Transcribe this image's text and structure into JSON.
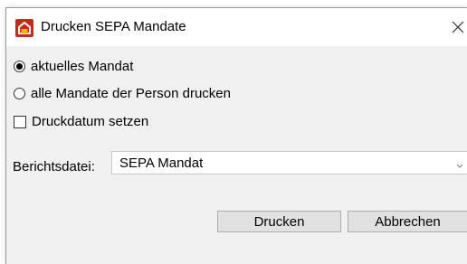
{
  "window": {
    "title": "Drucken SEPA Mandate",
    "icon": "app-house-icon",
    "close_icon": "close-icon"
  },
  "options": {
    "radio_current": {
      "label": "aktuelles Mandat",
      "checked": true
    },
    "radio_all": {
      "label": "alle Mandate der Person drucken",
      "checked": false
    },
    "checkbox_date": {
      "label": "Druckdatum setzen",
      "checked": false
    }
  },
  "report": {
    "label": "Berichtsdatei:",
    "selected": "SEPA Mandat"
  },
  "buttons": {
    "print": "Drucken",
    "cancel": "Abbrechen"
  },
  "colors": {
    "dialog_bg": "#f0f0f0",
    "button_bg": "#e1e1e1",
    "icon_red": "#c42b1c"
  }
}
